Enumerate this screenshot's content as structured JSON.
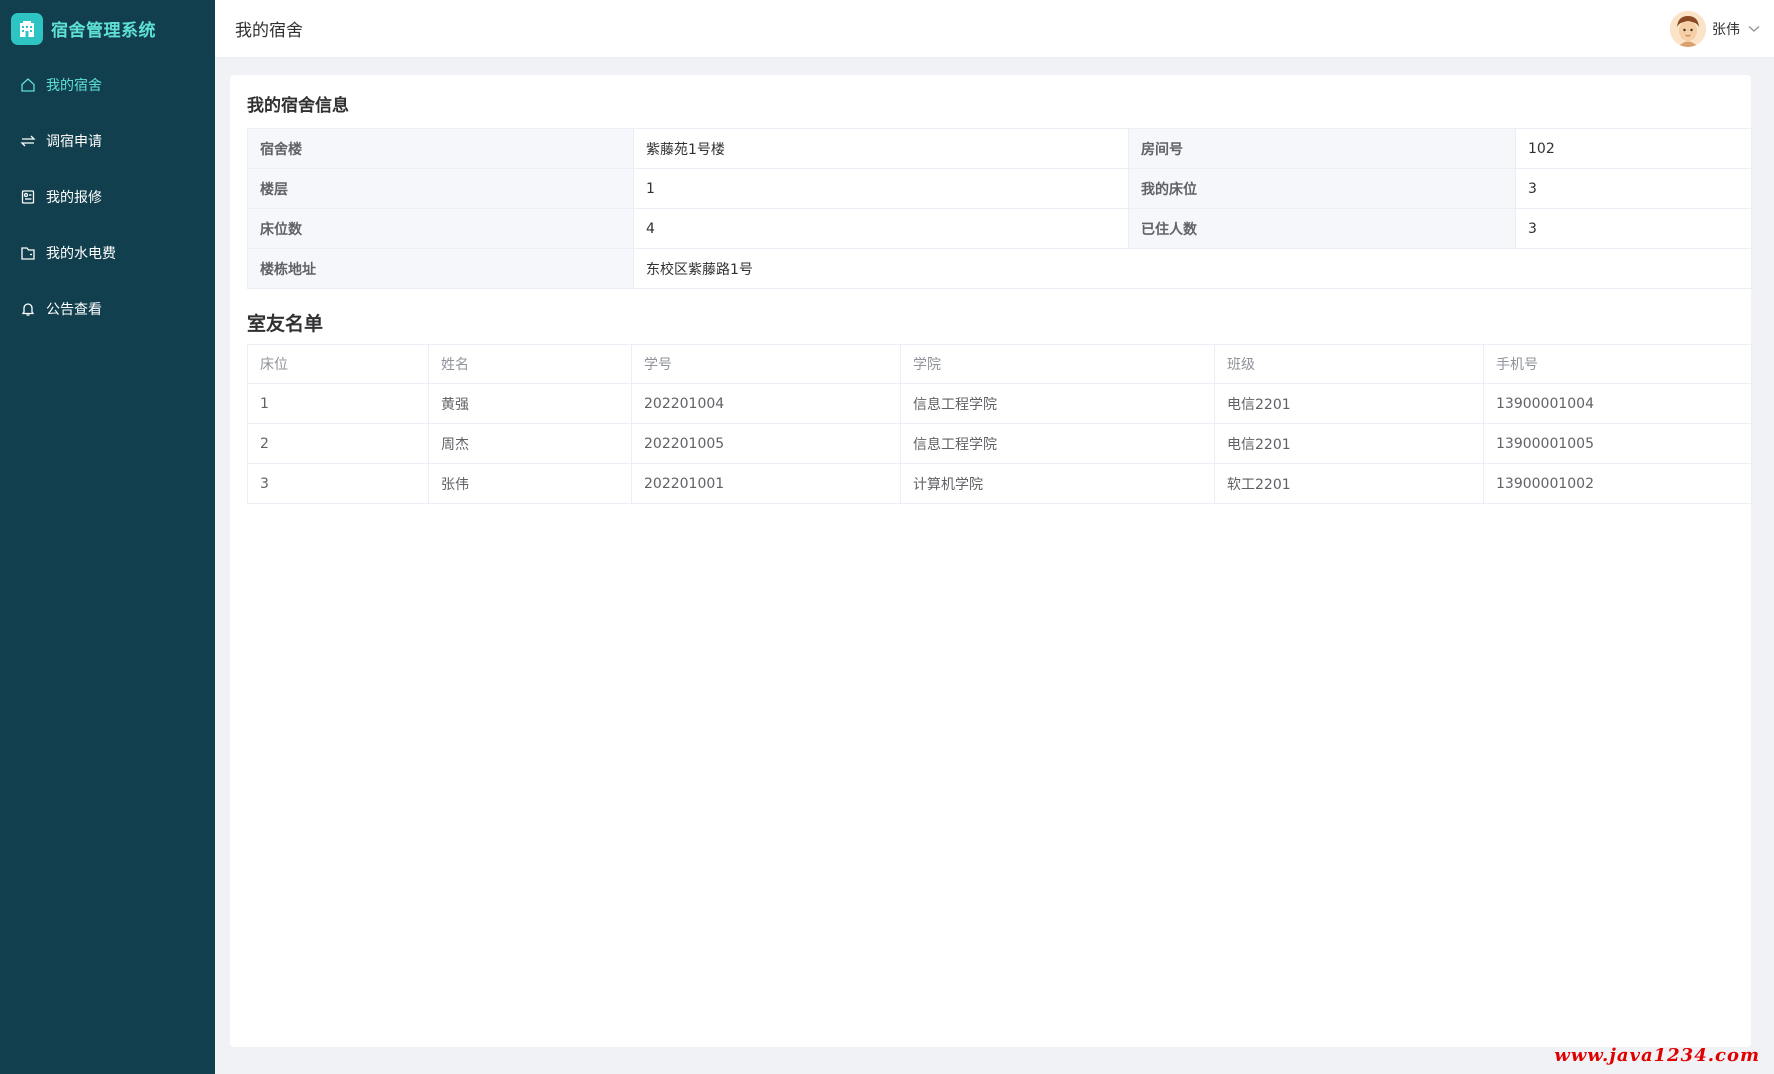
{
  "app": {
    "title": "宿舍管理系统",
    "watermark": "www.java1234.com"
  },
  "sidebar": {
    "items": [
      {
        "label": "我的宿舍",
        "icon": "home-icon",
        "active": true
      },
      {
        "label": "调宿申请",
        "icon": "switch-icon",
        "active": false
      },
      {
        "label": "我的报修",
        "icon": "repair-icon",
        "active": false
      },
      {
        "label": "我的水电费",
        "icon": "wallet-icon",
        "active": false
      },
      {
        "label": "公告查看",
        "icon": "bell-icon",
        "active": false
      }
    ]
  },
  "header": {
    "page_title": "我的宿舍",
    "user_name": "张伟"
  },
  "dorm_info": {
    "title": "我的宿舍信息",
    "rows": [
      {
        "l1": "宿舍楼",
        "v1": "紫藤苑1号楼",
        "l2": "房间号",
        "v2": "102"
      },
      {
        "l1": "楼层",
        "v1": "1",
        "l2": "我的床位",
        "v2": "3"
      },
      {
        "l1": "床位数",
        "v1": "4",
        "l2": "已住人数",
        "v2": "3"
      }
    ],
    "address_label": "楼栋地址",
    "address_value": "东校区紫藤路1号"
  },
  "roommates": {
    "title": "室友名单",
    "columns": [
      "床位",
      "姓名",
      "学号",
      "学院",
      "班级",
      "手机号"
    ],
    "rows": [
      [
        "1",
        "黄强",
        "202201004",
        "信息工程学院",
        "电信2201",
        "13900001004"
      ],
      [
        "2",
        "周杰",
        "202201005",
        "信息工程学院",
        "电信2201",
        "13900001005"
      ],
      [
        "3",
        "张伟",
        "202201001",
        "计算机学院",
        "软工2201",
        "13900001002"
      ]
    ]
  },
  "colors": {
    "sidebar_bg": "#113f4e",
    "accent": "#5ee0d6",
    "logo_bg": "#2ec4c4",
    "watermark": "#e00000"
  }
}
